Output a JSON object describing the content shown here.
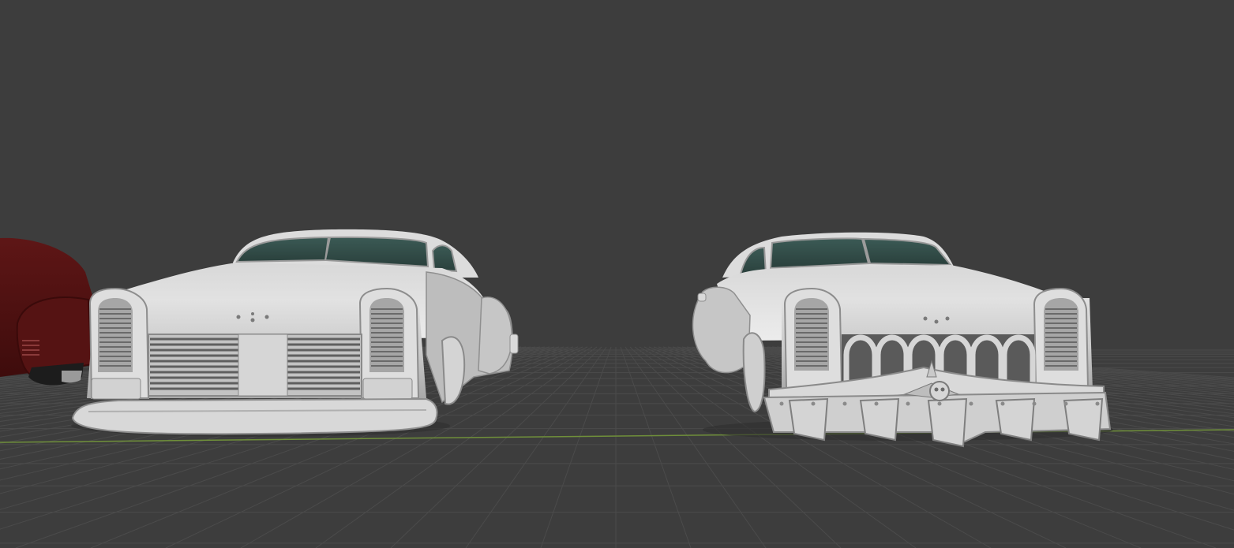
{
  "viewport": {
    "background": "#3d3d3d",
    "grid_color": "#4b4b4b",
    "x_axis_color": "#6f8f3a",
    "view": "perspective",
    "shading": "solid"
  },
  "objects": [
    {
      "name": "red-car-partial",
      "icon": "car-body-icon",
      "material_color": "#5a1414"
    },
    {
      "name": "car-model-standard",
      "icon": "car-body-icon",
      "material_color": "#cfcfcf",
      "windshield_color": "#2f4a45"
    },
    {
      "name": "car-model-armored",
      "icon": "car-body-icon",
      "material_color": "#cfcfcf",
      "windshield_color": "#2f4a45"
    }
  ]
}
